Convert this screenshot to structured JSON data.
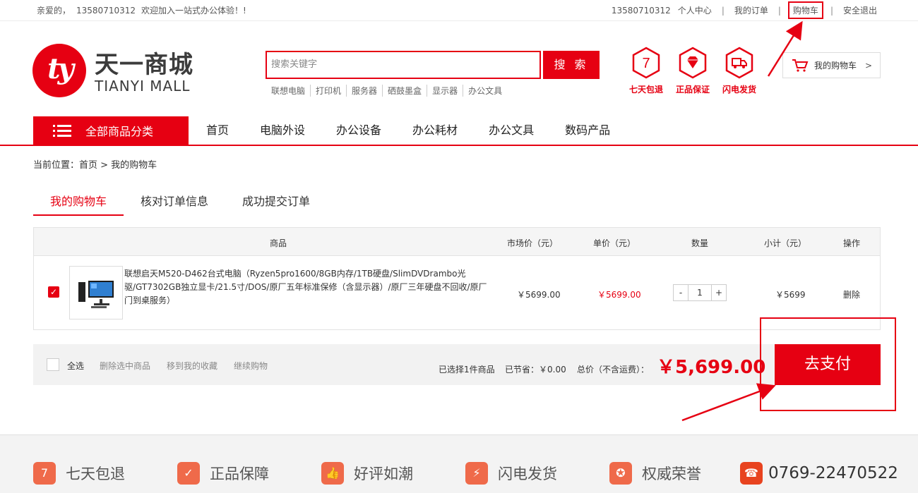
{
  "topbar": {
    "greeting": "亲爱的，",
    "phone": "13580710312",
    "welcome": "欢迎加入一站式办公体验！!",
    "account_phone": "13580710312",
    "links": [
      "个人中心",
      "我的订单",
      "购物车",
      "安全退出"
    ]
  },
  "logo": {
    "mark": "ty",
    "cn": "天一商城",
    "en": "TIANYI MALL"
  },
  "search": {
    "placeholder": "搜索关键字",
    "button": "搜 索",
    "hotwords": [
      "联想电脑",
      "打印机",
      "服务器",
      "硒鼓墨盒",
      "显示器",
      "办公文具"
    ]
  },
  "promises": [
    {
      "icon": "seven-icon",
      "label": "七天包退"
    },
    {
      "icon": "diamond-icon",
      "label": "正品保证"
    },
    {
      "icon": "truck-icon",
      "label": "闪电发货"
    }
  ],
  "mycart": {
    "label": "我的购物车",
    "arrow": ">"
  },
  "nav": {
    "all": "全部商品分类",
    "items": [
      "首页",
      "电脑外设",
      "办公设备",
      "办公耗材",
      "办公文具",
      "数码产品"
    ]
  },
  "breadcrumb": "当前位置：首页 > 我的购物车",
  "steps": [
    "我的购物车",
    "核对订单信息",
    "成功提交订单"
  ],
  "table": {
    "headers": [
      "商品",
      "市场价（元）",
      "单价（元）",
      "数量",
      "小计（元）",
      "操作"
    ],
    "rows": [
      {
        "checked": true,
        "name": "联想启天M520-D462台式电脑（Ryzen5pro1600/8GB内存/1TB硬盘/SlimDVDrambo光驱/GT7302GB独立显卡/21.5寸/DOS/原厂五年标准保修（含显示器）/原厂三年硬盘不回收/原厂门到桌服务）",
        "market_price": "￥5699.00",
        "unit_price": "￥5699.00",
        "qty": "1",
        "minus": "-",
        "plus": "+",
        "subtotal": "￥5699",
        "action": "删除"
      }
    ]
  },
  "footer_bar": {
    "select_all": "全选",
    "delete_selected": "删除选中商品",
    "move_fav": "移到我的收藏",
    "continue": "继续购物",
    "selected": "已选择1件商品",
    "saved": "已节省：￥0.00",
    "total_label": "总价（不含运费）：",
    "total": "￥5,699.00",
    "pay": "去支付"
  },
  "footer": {
    "items": [
      {
        "icon": "bag-icon",
        "label": "七天包退"
      },
      {
        "icon": "shield-icon",
        "label": "正品保障"
      },
      {
        "icon": "thumbs-up-icon",
        "label": "好评如潮"
      },
      {
        "icon": "lightning-icon",
        "label": "闪电发货"
      },
      {
        "icon": "medal-icon",
        "label": "权威荣誉"
      }
    ],
    "phone": "0769-22470522"
  },
  "colors": {
    "brand": "#e60012",
    "footer_icon": "#ef6a4a"
  }
}
